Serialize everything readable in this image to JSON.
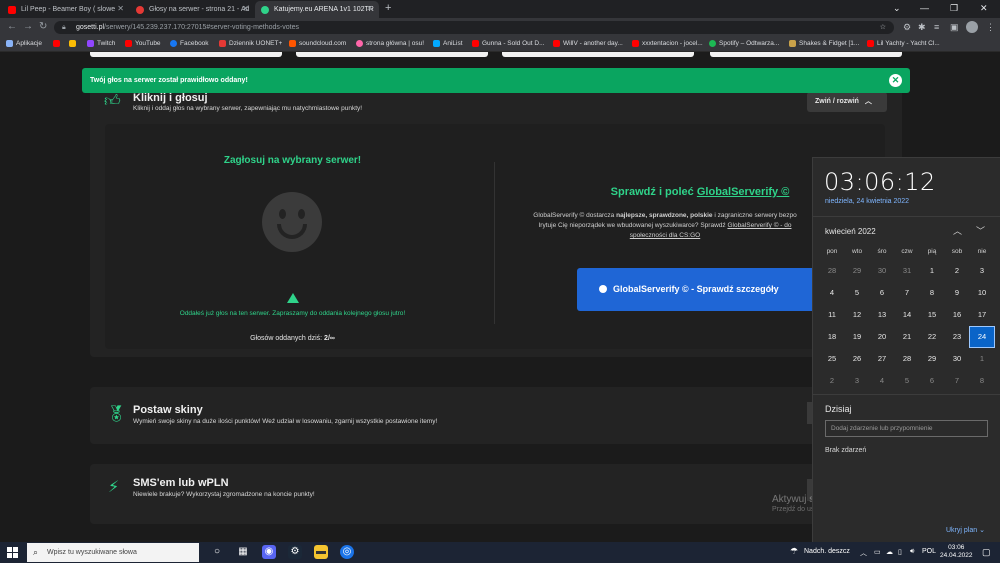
{
  "browser": {
    "tabs": [
      {
        "title": "Lil Peep - Beamer Boy ( slowe",
        "color": "#ff0000"
      },
      {
        "title": "Głosy na serwer - strona 21 - Ad",
        "color": "#e53935"
      },
      {
        "title": "Katujemy.eu ARENA 1v1 102TR ",
        "color": "#2fd38a"
      }
    ],
    "url_host": "gosetti.pl",
    "url_path": "/serwery/145.239.237.170:27015#server-voting-methods-votes",
    "bookmarks": [
      {
        "label": "Aplikacje",
        "color": "#8ab4f8"
      },
      {
        "label": "",
        "color": "#ff0000"
      },
      {
        "label": "",
        "color": "#fbbc04"
      },
      {
        "label": "Twitch",
        "color": "#9146ff"
      },
      {
        "label": "YouTube",
        "color": "#ff0000"
      },
      {
        "label": "Facebook",
        "color": "#1877f2"
      },
      {
        "label": "Dziennik UONET+",
        "color": "#e53935"
      },
      {
        "label": "soundcloud.com",
        "color": "#ff5500"
      },
      {
        "label": "strona główna | osu!",
        "color": "#ff66aa"
      },
      {
        "label": "AniList",
        "color": "#02a9ff"
      },
      {
        "label": "Gunna - Sold Out D...",
        "color": "#ff0000"
      },
      {
        "label": "WillV - another day...",
        "color": "#ff0000"
      },
      {
        "label": "xxxtentacion - jocel...",
        "color": "#ff0000"
      },
      {
        "label": "Spotify – Odtwarza...",
        "color": "#1db954"
      },
      {
        "label": "Shakes & Fidget [1...",
        "color": "#c9a24a"
      },
      {
        "label": "Lil Yachty - Yacht Cl...",
        "color": "#ff0000"
      }
    ]
  },
  "toast": {
    "message": "Twój głos na serwer został prawidłowo oddany!"
  },
  "vote_section": {
    "title": "Kliknij i głosuj",
    "description": "Kliknij i oddaj głos na wybrany serwer, zapewniając mu natychmiastowe punkty!",
    "toggle_label": "Zwiń / rozwiń",
    "vote_heading": "Zagłosuj na wybrany serwer!",
    "voted_message": "Oddałeś już głos na ten serwer. Zapraszamy do oddania kolejnego głosu jutro!",
    "votes_today_label": "Głosów oddanych dziś:",
    "votes_today_value": "2/∞"
  },
  "globalserverify": {
    "title_prefix": "Sprawdź i poleć",
    "title_link": "GlobalServerify ©",
    "text_1": "GlobalServerify © dostarcza",
    "text_bold": "najlepsze, sprawdzone, polskie",
    "text_2": "i zagraniczne serwery bezpo",
    "text_3": "Irytuje Cię nieporządek we wbudowanej wyszukiwarce? Sprawdź",
    "text_link": "GlobalServerify © - do",
    "text_4": "społeczności dla CS:GO",
    "button_label": "GlobalServerify © - Sprawdź szczegóły"
  },
  "skins_section": {
    "title": "Postaw skiny",
    "description": "Wymień swoje skiny na duże ilości punktów! Weź udział w losowaniu, zgarnij wszystkie postawione itemy!"
  },
  "sms_section": {
    "title": "SMS'em lub wPLN",
    "description": "Niewiele brakuje? Wykorzystaj zgromadzone na koncie punkty!"
  },
  "calendar": {
    "time": "03:06:12",
    "full_date": "niedziela, 24 kwietnia 2022",
    "month_label": "kwiecień 2022",
    "weekdays": [
      "pon",
      "wto",
      "śro",
      "czw",
      "pią",
      "sob",
      "nie"
    ],
    "weeks": [
      [
        "28",
        "29",
        "30",
        "31",
        "1",
        "2",
        "3"
      ],
      [
        "4",
        "5",
        "6",
        "7",
        "8",
        "9",
        "10"
      ],
      [
        "11",
        "12",
        "13",
        "14",
        "15",
        "16",
        "17"
      ],
      [
        "18",
        "19",
        "20",
        "21",
        "22",
        "23",
        "24"
      ],
      [
        "25",
        "26",
        "27",
        "28",
        "29",
        "30",
        "1"
      ],
      [
        "2",
        "3",
        "4",
        "5",
        "6",
        "7",
        "8"
      ]
    ],
    "today": "24",
    "today_label": "Dzisiaj",
    "event_placeholder": "Dodaj zdarzenie lub przypomnienie",
    "no_events": "Brak zdarzeń",
    "hide_plan": "Ukryj plan"
  },
  "watermark": {
    "line1": "Aktywuj system Windows",
    "line2": "Przejdź do ustawień, aby aktywować system Windows"
  },
  "taskbar": {
    "search_placeholder": "Wpisz tu wyszukiwane słowa",
    "weather": "Nadch. deszcz",
    "language": "POL",
    "time": "03:06",
    "date": "24.04.2022"
  }
}
